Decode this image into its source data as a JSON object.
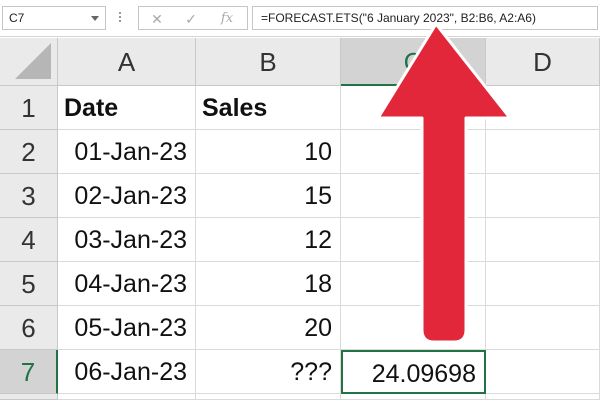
{
  "formula_bar": {
    "name_box": "C7",
    "cancel_icon": "✕",
    "enter_icon": "✓",
    "fx_label": "fx",
    "formula": "=FORECAST.ETS(\"6 January 2023\", B2:B6, A2:A6)"
  },
  "columns": [
    "A",
    "B",
    "C",
    "D"
  ],
  "rows": [
    "1",
    "2",
    "3",
    "4",
    "5",
    "6",
    "7"
  ],
  "cells": {
    "A1": "Date",
    "B1": "Sales",
    "A2": "01-Jan-23",
    "B2": "10",
    "A3": "02-Jan-23",
    "B3": "15",
    "A4": "03-Jan-23",
    "B4": "12",
    "A5": "04-Jan-23",
    "B5": "18",
    "A6": "05-Jan-23",
    "B6": "20",
    "A7": "06-Jan-23",
    "B7": "???",
    "C7": "24.09698"
  },
  "selection": {
    "active_cell": "C7",
    "column": "C",
    "row": "7"
  },
  "colors": {
    "accent": "#217346",
    "arrow": "#e3273a"
  },
  "icons": [
    "dropdown-caret-icon",
    "cancel-icon",
    "enter-icon",
    "fx-icon",
    "select-all-icon",
    "up-arrow-icon"
  ]
}
